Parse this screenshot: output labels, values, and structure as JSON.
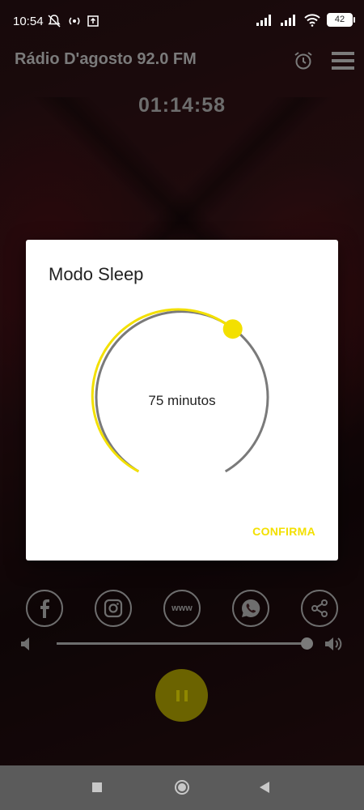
{
  "status_bar": {
    "time": "10:54",
    "battery": "42"
  },
  "app": {
    "title": "Rádio D'agosto 92.0 FM",
    "timer": "01:14:58"
  },
  "dialog": {
    "title": "Modo Sleep",
    "value_label": "75 minutos",
    "value_minutes": 75,
    "confirm_label": "CONFIRMA"
  },
  "social": [
    {
      "name": "facebook-icon"
    },
    {
      "name": "instagram-icon"
    },
    {
      "name": "www-icon",
      "text": "www"
    },
    {
      "name": "whatsapp-icon"
    },
    {
      "name": "share-icon"
    }
  ],
  "volume": {
    "level": 0.97
  },
  "colors": {
    "accent": "#f3e000",
    "dial_track": "#7a7a7a",
    "icon_gray": "#6e6e6e"
  }
}
